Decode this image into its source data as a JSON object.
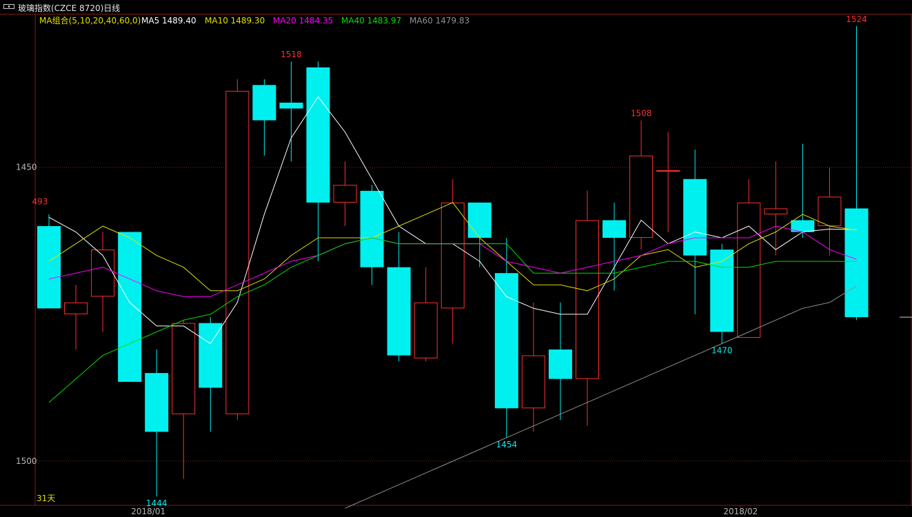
{
  "window": {
    "title": "玻璃指数(CZCE 8720)日线"
  },
  "ma_legend": {
    "group": {
      "text": "MA组合(5,10,20,40,60,0)",
      "color": "#e0e000"
    },
    "items": [
      {
        "text": "MA5 1489.40",
        "color": "#ffffff"
      },
      {
        "text": "MA10 1489.30",
        "color": "#e0e000"
      },
      {
        "text": "MA20 1484.35",
        "color": "#ff00ff"
      },
      {
        "text": "MA40 1483.97",
        "color": "#00e000"
      },
      {
        "text": "MA60 1479.83",
        "color": "#909090"
      }
    ]
  },
  "axis": {
    "y_ticks": [
      "1500",
      "1450"
    ],
    "x_ticks": [
      "2018/01",
      "2018/02"
    ],
    "period_label": "31天"
  },
  "colors": {
    "up": "#ff3030",
    "down": "#00f0f0",
    "grid": "#8a1a1a"
  },
  "chart_data": {
    "type": "candlestick",
    "title": "玻璃指数(CZCE 8720)日线",
    "ylim": [
      1442.5,
      1526
    ],
    "y_ticks": [
      1450,
      1500
    ],
    "x_tick_labels": [
      {
        "label": "2018/01",
        "index": 4
      },
      {
        "label": "2018/02",
        "index": 26
      }
    ],
    "candles": [
      {
        "open": 1490,
        "high": 1492,
        "low": 1477,
        "close": 1476
      },
      {
        "open": 1475,
        "high": 1480,
        "low": 1469,
        "close": 1477
      },
      {
        "open": 1478,
        "high": 1489,
        "low": 1472,
        "close": 1486
      },
      {
        "open": 1489,
        "high": 1489,
        "low": 1465,
        "close": 1463.5
      },
      {
        "open": 1465,
        "high": 1469,
        "low": 1444,
        "close": 1455
      },
      {
        "open": 1458,
        "high": 1474,
        "low": 1447,
        "close": 1473.5
      },
      {
        "open": 1473.5,
        "high": 1474.5,
        "low": 1455,
        "close": 1462.5
      },
      {
        "open": 1458,
        "high": 1515,
        "low": 1457,
        "close": 1513
      },
      {
        "open": 1514,
        "high": 1515,
        "low": 1502,
        "close": 1508
      },
      {
        "open": 1511,
        "high": 1518,
        "low": 1501,
        "close": 1510
      },
      {
        "open": 1517,
        "high": 1518,
        "low": 1484,
        "close": 1494
      },
      {
        "open": 1494,
        "high": 1501,
        "low": 1490,
        "close": 1497
      },
      {
        "open": 1496,
        "high": 1497,
        "low": 1480,
        "close": 1483
      },
      {
        "open": 1483,
        "high": 1489,
        "low": 1467,
        "close": 1468
      },
      {
        "open": 1467.5,
        "high": 1483,
        "low": 1467,
        "close": 1477
      },
      {
        "open": 1476,
        "high": 1498,
        "low": 1470,
        "close": 1494
      },
      {
        "open": 1494,
        "high": 1494,
        "low": 1483,
        "close": 1488
      },
      {
        "open": 1482,
        "high": 1488,
        "low": 1454,
        "close": 1459
      },
      {
        "open": 1459,
        "high": 1477,
        "low": 1455,
        "close": 1468
      },
      {
        "open": 1469,
        "high": 1477,
        "low": 1457,
        "close": 1464
      },
      {
        "open": 1464,
        "high": 1496,
        "low": 1456,
        "close": 1491
      },
      {
        "open": 1491,
        "high": 1494,
        "low": 1479,
        "close": 1488
      },
      {
        "open": 1488,
        "high": 1508,
        "low": 1486,
        "close": 1502
      },
      {
        "open": 1499.5,
        "high": 1506,
        "low": 1489,
        "close": 1499.5
      },
      {
        "open": 1498,
        "high": 1503,
        "low": 1475,
        "close": 1485
      },
      {
        "open": 1486,
        "high": 1487,
        "low": 1470,
        "close": 1472
      },
      {
        "open": 1471,
        "high": 1498,
        "low": 1471,
        "close": 1494
      },
      {
        "open": 1492,
        "high": 1501,
        "low": 1485,
        "close": 1493
      },
      {
        "open": 1491,
        "high": 1504,
        "low": 1488,
        "close": 1489
      },
      {
        "open": 1490,
        "high": 1500,
        "low": 1485,
        "close": 1495
      },
      {
        "open": 1493,
        "high": 1524,
        "low": 1474,
        "close": 1474.5
      }
    ],
    "annotations": [
      {
        "label": "493",
        "index": 0,
        "value": 1493,
        "color": "up"
      },
      {
        "label": "1444",
        "index": 4,
        "value": 1444,
        "color": "down"
      },
      {
        "label": "1518",
        "index": 9,
        "value": 1518,
        "color": "up"
      },
      {
        "label": "1454",
        "index": 17,
        "value": 1454,
        "color": "down"
      },
      {
        "label": "1508",
        "index": 22,
        "value": 1508,
        "color": "up"
      },
      {
        "label": "1470",
        "index": 25,
        "value": 1470,
        "color": "down"
      },
      {
        "label": "1524",
        "index": 30,
        "value": 1524,
        "color": "up"
      }
    ],
    "series": [
      {
        "name": "MA5",
        "color": "#ffffff",
        "values": [
          1491.5,
          1489,
          1485,
          1477,
          1473,
          1473,
          1470,
          1477,
          1492,
          1505,
          1512,
          1506,
          1498,
          1490,
          1487,
          1487,
          1484,
          1478,
          1476,
          1475,
          1475,
          1483,
          1491,
          1487,
          1489,
          1488,
          1490,
          1486,
          1489,
          1489.5,
          1489.4
        ]
      },
      {
        "name": "MA10",
        "color": "#e0e000",
        "values": [
          1484,
          1487,
          1490,
          1488,
          1485,
          1483,
          1479,
          1479,
          1481,
          1485,
          1488,
          1488,
          1488,
          1490,
          1492,
          1494,
          1488,
          1484,
          1480,
          1480,
          1479,
          1481,
          1485,
          1486,
          1483,
          1484,
          1487,
          1489,
          1492,
          1490,
          1489.3
        ]
      },
      {
        "name": "MA20",
        "color": "#ff00ff",
        "values": [
          1481,
          1482,
          1483,
          1481,
          1479,
          1478,
          1478,
          1480,
          1482,
          1484,
          1485,
          1487,
          1488,
          1487,
          1487,
          1487,
          1487,
          1484,
          1483,
          1482,
          1483,
          1484,
          1485,
          1487,
          1488,
          1488,
          1488,
          1490,
          1489,
          1486,
          1484.35
        ]
      },
      {
        "name": "MA40",
        "color": "#00e000",
        "values": [
          1460,
          1464,
          1468,
          1470,
          1472,
          1474,
          1475,
          1478,
          1480,
          1483,
          1485,
          1487,
          1488,
          1487,
          1487,
          1487,
          1487,
          1487,
          1482,
          1482,
          1482,
          1482,
          1483,
          1484,
          1484,
          1483,
          1483,
          1484,
          1484,
          1484,
          1483.97
        ]
      },
      {
        "name": "MA60",
        "color": "#909090",
        "values": [
          null,
          null,
          null,
          null,
          null,
          null,
          null,
          null,
          null,
          null,
          null,
          1442,
          1444,
          1446,
          1448,
          1450,
          1452,
          1454,
          1456,
          1458,
          1460,
          1462,
          1464,
          1466,
          1468,
          1470,
          1472,
          1474,
          1476,
          1477,
          1479.83
        ]
      }
    ]
  }
}
